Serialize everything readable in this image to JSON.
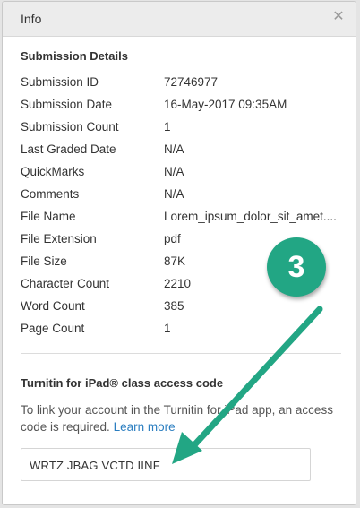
{
  "dialog": {
    "title": "Info",
    "close_icon": "close-icon"
  },
  "details": {
    "heading": "Submission Details",
    "rows": [
      {
        "label": "Submission ID",
        "value": "72746977"
      },
      {
        "label": "Submission Date",
        "value": "16-May-2017 09:35AM"
      },
      {
        "label": "Submission Count",
        "value": "1"
      },
      {
        "label": "Last Graded Date",
        "value": "N/A"
      },
      {
        "label": "QuickMarks",
        "value": "N/A"
      },
      {
        "label": "Comments",
        "value": "N/A"
      },
      {
        "label": "File Name",
        "value": "Lorem_ipsum_dolor_sit_amet...."
      },
      {
        "label": "File Extension",
        "value": "pdf"
      },
      {
        "label": "File Size",
        "value": "87K"
      },
      {
        "label": "Character Count",
        "value": "2210"
      },
      {
        "label": "Word Count",
        "value": "385"
      },
      {
        "label": "Page Count",
        "value": "1"
      }
    ]
  },
  "ipad": {
    "heading": "Turnitin for iPad® class access code",
    "text": "To link your account in the Turnitin for iPad app, an access code is required.",
    "learn_more": "Learn more",
    "code": "WRTZ JBAG VCTD IINF"
  },
  "callout": {
    "number": "3",
    "color": "#22a684"
  }
}
